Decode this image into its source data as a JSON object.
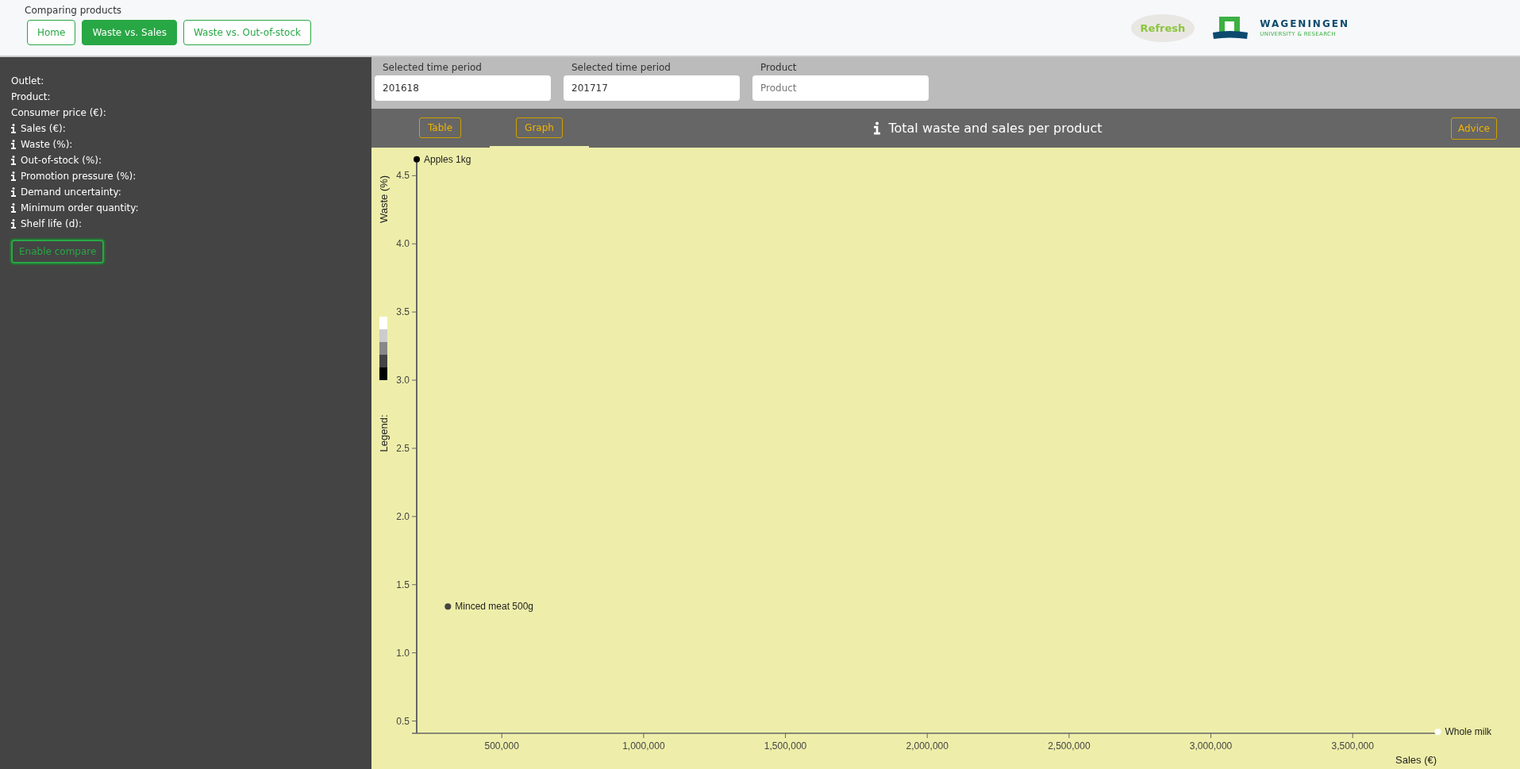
{
  "header": {
    "title": "Comparing products",
    "nav": [
      {
        "label": "Home",
        "selected": false
      },
      {
        "label": "Waste vs. Sales",
        "selected": true
      },
      {
        "label": "Waste vs. Out-of-stock",
        "selected": false
      }
    ],
    "logo_refresh": "Refresh",
    "logo_wur": {
      "name": "WAGENINGEN",
      "subtitle": "UNIVERSITY & RESEARCH"
    }
  },
  "sidebar": {
    "fields": [
      {
        "label": "Outlet:",
        "info": false
      },
      {
        "label": "Product:",
        "info": false
      },
      {
        "label": "Consumer price (€):",
        "info": false
      },
      {
        "label": "Sales (€):",
        "info": true
      },
      {
        "label": "Waste (%):",
        "info": true
      },
      {
        "label": "Out-of-stock (%):",
        "info": true
      },
      {
        "label": "Promotion pressure (%):",
        "info": true
      },
      {
        "label": "Demand uncertainty:",
        "info": true
      },
      {
        "label": "Minimum order quantity:",
        "info": true
      },
      {
        "label": "Shelf life (d):",
        "info": true
      }
    ],
    "compare_button": "Enable compare"
  },
  "filters": [
    {
      "label": "Selected time period",
      "value": "201618"
    },
    {
      "label": "Selected time period",
      "value": "201717"
    },
    {
      "label": "Product",
      "placeholder": "Product"
    }
  ],
  "view_tabs": [
    {
      "label": "Table",
      "selected": false
    },
    {
      "label": "Graph",
      "selected": true
    }
  ],
  "panel_title": "Total waste and sales per product",
  "advice_button": "Advice",
  "chart": {
    "legend_label": "Legend:",
    "legend": [
      {
        "color": "#ffffff"
      },
      {
        "color": "#cccccc"
      },
      {
        "color": "#888888"
      },
      {
        "color": "#444444"
      },
      {
        "color": "#000000"
      }
    ],
    "chart_data": {
      "type": "scatter",
      "xlabel": "Sales (€)",
      "ylabel": "Waste (%)",
      "xlim": [
        200000,
        3810000
      ],
      "ylim": [
        0.41,
        4.63
      ],
      "xticks": [
        {
          "value": 500000,
          "label": "500,000"
        },
        {
          "value": 1000000,
          "label": "1,000,000"
        },
        {
          "value": 1500000,
          "label": "1,500,000"
        },
        {
          "value": 2000000,
          "label": "2,000,000"
        },
        {
          "value": 2500000,
          "label": "2,500,000"
        },
        {
          "value": 3000000,
          "label": "3,000,000"
        },
        {
          "value": 3500000,
          "label": "3,500,000"
        }
      ],
      "yticks": [
        {
          "value": 0.5,
          "label": "0.5"
        },
        {
          "value": 1,
          "label": "1.0"
        },
        {
          "value": 1.5,
          "label": "1.5"
        },
        {
          "value": 2,
          "label": "2.0"
        },
        {
          "value": 2.5,
          "label": "2.5"
        },
        {
          "value": 3,
          "label": "3.0"
        },
        {
          "value": 3.5,
          "label": "3.5"
        },
        {
          "value": 4,
          "label": "4.0"
        },
        {
          "value": 4.5,
          "label": "4.5"
        }
      ],
      "series": [
        {
          "name": "Apples 1kg",
          "color": "#000000",
          "x": [
            200000
          ],
          "values": [
            4.62
          ]
        },
        {
          "name": "Minced meat 500g",
          "color": "#444444",
          "x": [
            310000
          ],
          "values": [
            1.34
          ]
        },
        {
          "name": "Whole milk",
          "color": "#ffffff",
          "x": [
            3800000
          ],
          "values": [
            0.42
          ]
        }
      ]
    }
  }
}
